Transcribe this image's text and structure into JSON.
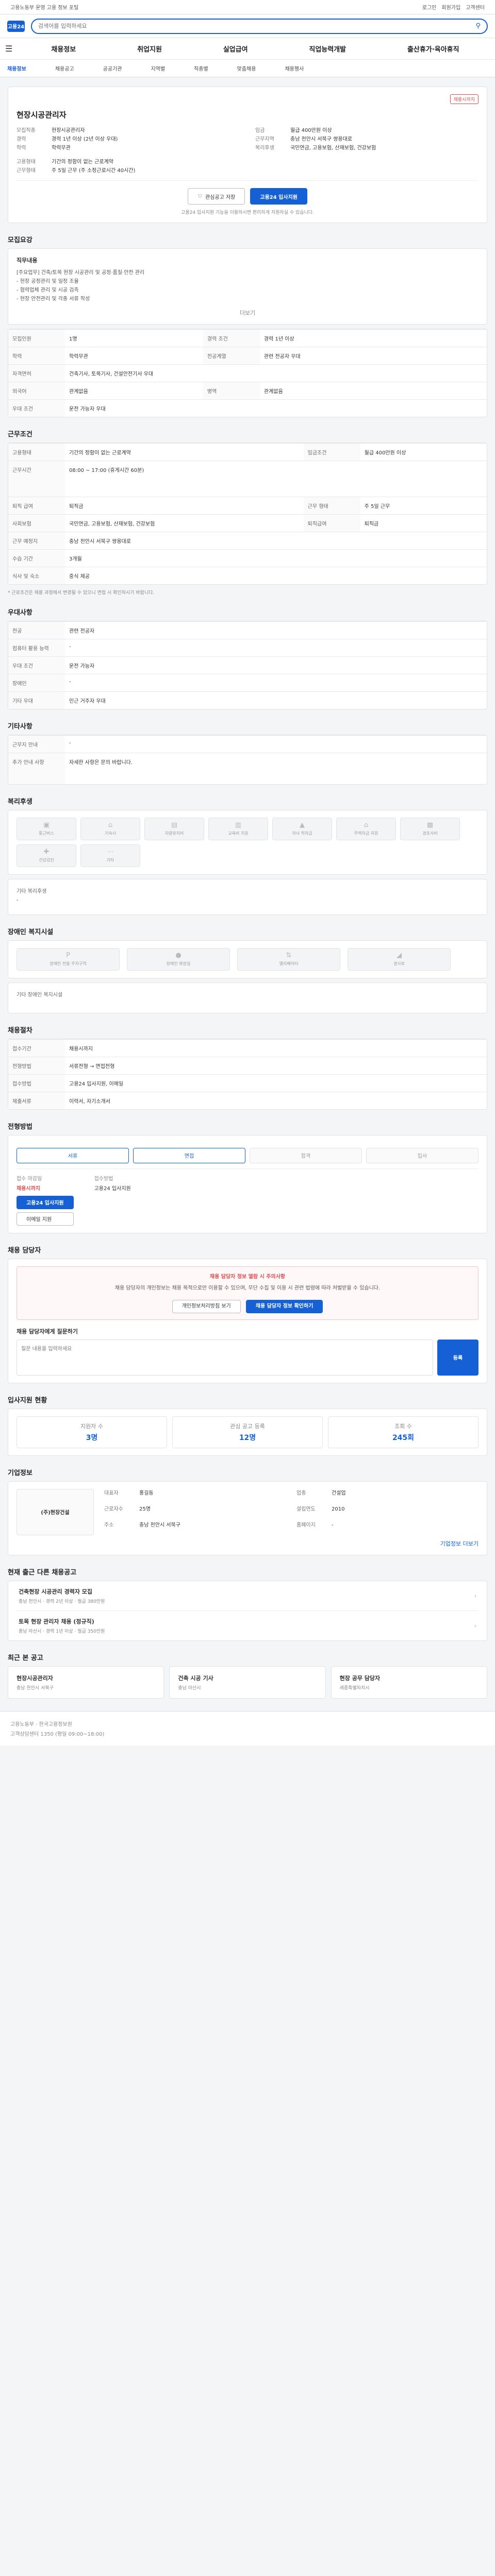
{
  "header": {
    "left_text": "고용노동부 운영 고용 정보 포털",
    "right_links": [
      "로그인",
      "회원가입",
      "고객센터"
    ],
    "logo": "고용24",
    "search_placeholder": "검색어를 입력하세요",
    "search_icon": "search-icon"
  },
  "nav": {
    "items": [
      "채용정보",
      "취업지원",
      "실업급여",
      "직업능력개발",
      "출산휴가·육아휴직"
    ],
    "sub": [
      "채용정보",
      "채용공고",
      "공공기관",
      "지역별",
      "직종별",
      "맞춤채용",
      "채용행사"
    ]
  },
  "job": {
    "org": "현장시공관리자",
    "badge": "채용시까지",
    "fields": [
      {
        "k": "모집직종",
        "v": "현장시공관리자"
      },
      {
        "k": "경력",
        "v": "경력 1년 이상 (2년 이상 우대)"
      },
      {
        "k": "학력",
        "v": "학력무관"
      },
      {
        "k": "고용형태",
        "v": "기간의 정함이 없는 근로계약"
      },
      {
        "k": "근무형태",
        "v": "주 5일 근무 (주 소정근로시간 40시간)"
      }
    ],
    "fields_right": [
      {
        "k": "임금",
        "v": "월급 400만원 이상"
      },
      {
        "k": "근무지역",
        "v": "충남 천안시 서북구 쌍용대로"
      },
      {
        "k": "복리후생",
        "v": "국민연금, 고용보험, 산재보험, 건강보험"
      }
    ],
    "btn_save": "관심공고 저장",
    "btn_apply": "고용24 입사지원",
    "apply_note": "고용24 입사지원 기능을 이용하시면 편리하게 지원하실 수 있습니다."
  },
  "sections": {
    "recruit": "모집요강",
    "conditions": "근무조건",
    "preference": "우대사항",
    "other": "기타사항",
    "welfare": "복리후생",
    "disability": "장애인 복지시설",
    "process": "채용절차",
    "docs": "전형방법",
    "manager": "채용 담당자",
    "status": "입사지원 현황",
    "agency": "기업정보",
    "similar": "현재 출근 다른 채용공고",
    "recent": "최근 본 공고"
  },
  "recruit_detail": {
    "title": "직무내용",
    "body": [
      "[주요업무] 건축/토목 현장 시공관리 및 공정·품질·안전 관리",
      "- 현장 공정관리 및 일정 조율",
      "- 협력업체 관리 및 시공 검측",
      "- 현장 안전관리 및 각종 서류 작성"
    ],
    "detail_link": "더보기"
  },
  "recruit_table": [
    {
      "k": "모집인원",
      "v": "1명",
      "k2": "경력 조건",
      "v2": "경력 1년 이상"
    },
    {
      "k": "학력",
      "v": "학력무관",
      "k2": "전공계열",
      "v2": "관련 전공자 우대"
    },
    {
      "k": "자격면허",
      "v": "건축기사, 토목기사, 건설안전기사 우대",
      "k2": "",
      "v2": ""
    },
    {
      "k": "외국어",
      "v": "관계없음",
      "k2": "병역",
      "v2": "관계없음"
    },
    {
      "k": "우대 조건",
      "v": "운전 가능자 우대",
      "k2": "",
      "v2": ""
    }
  ],
  "cond_table": [
    {
      "k": "고용형태",
      "v": "기간의 정함이 없는 근로계약",
      "k2": "임금조건",
      "v2": "월급 400만원 이상"
    },
    {
      "k": "근무시간",
      "v": "08:00 ~ 17:00 (휴게시간 60분)",
      "k2": "",
      "v2": ""
    },
    {
      "k": "퇴직 급여",
      "v": "퇴직금",
      "k2": "근무 형태",
      "v2": "주 5일 근무"
    },
    {
      "k": "사회보험",
      "v": "국민연금, 고용보험, 산재보험, 건강보험",
      "k2": "퇴직급여",
      "v2": "퇴직금"
    },
    {
      "k": "근무 예정지",
      "v": "충남 천안시 서북구 쌍용대로",
      "k2": "",
      "v2": ""
    },
    {
      "k": "수습 기간",
      "v": "3개월",
      "k2": "",
      "v2": ""
    },
    {
      "k": "식사 및 숙소",
      "v": "중식 제공",
      "k2": "",
      "v2": ""
    }
  ],
  "cond_note": "* 근로조건은 채용 과정에서 변경될 수 있으니 면접 시 확인하시기 바랍니다.",
  "pref_table": [
    {
      "k": "전공",
      "v": "관련 전공자"
    },
    {
      "k": "컴퓨터 활용 능력",
      "v": "-"
    },
    {
      "k": "우대 조건",
      "v": "운전 가능자"
    },
    {
      "k": "장애인",
      "v": "-"
    },
    {
      "k": "기타 우대",
      "v": "인근 거주자 우대"
    }
  ],
  "other_table": [
    {
      "k": "근무지 안내",
      "v": "-"
    },
    {
      "k": "추가 안내 사항",
      "v": "자세한 사항은 문의 바랍니다."
    }
  ],
  "welfare_items": [
    "통근버스",
    "기숙사",
    "차량유지비",
    "교육비 지원",
    "자녀 학자금",
    "주택자금 지원",
    "경조사비",
    "건강검진",
    "기타"
  ],
  "welfare_other": "기타 복리후생",
  "welfare_other_val": "-",
  "disability_items": [
    "장애인 전용 주차구역",
    "장애인 화장실",
    "엘리베이터",
    "경사로"
  ],
  "disability_other": "기타 장애인 복지시설",
  "process_table": [
    {
      "k": "접수기간",
      "v": "채용시까지",
      "k2": "",
      "v2": ""
    },
    {
      "k": "전형방법",
      "v": "서류전형 → 면접전형",
      "k2": "",
      "v2": ""
    },
    {
      "k": "접수방법",
      "v": "고용24 입사지원, 이메일",
      "k2": "",
      "v2": ""
    },
    {
      "k": "제출서류",
      "v": "이력서, 자기소개서",
      "k2": "",
      "v2": ""
    }
  ],
  "steps": [
    "서류",
    "면접",
    "합격",
    "입사"
  ],
  "deadline": {
    "label": "접수 마감일",
    "value": "채용시까지",
    "method_label": "접수방법",
    "method_value": "고용24 입사지원",
    "apply_btn": "고용24 입사지원",
    "email_btn": "이메일 지원"
  },
  "manager": {
    "alert": "채용 담당자 정보 열람 시 주의사항",
    "alert_body": "채용 담당자의 개인정보는 채용 목적으로만 이용할 수 있으며, 무단 수집 및 이용 시 관련 법령에 따라 처벌받을 수 있습니다.",
    "btn1": "개인정보처리방침 보기",
    "btn2": "채용 담당자 정보 확인하기",
    "inquiry_title": "채용 담당자에게 질문하기",
    "inquiry_placeholder": "질문 내용을 입력하세요",
    "submit": "등록"
  },
  "status": {
    "stats": [
      {
        "label": "지원자 수",
        "value": "3명"
      },
      {
        "label": "관심 공고 등록",
        "value": "12명"
      },
      {
        "label": "조회 수",
        "value": "245회"
      }
    ]
  },
  "company": {
    "name": "(주)현장건설",
    "fields": [
      {
        "k": "대표자",
        "v": "홍길동"
      },
      {
        "k": "업종",
        "v": "건설업"
      },
      {
        "k": "근로자수",
        "v": "25명"
      },
      {
        "k": "설립연도",
        "v": "2010"
      },
      {
        "k": "주소",
        "v": "충남 천안시 서북구"
      },
      {
        "k": "홈페이지",
        "v": "-"
      }
    ],
    "more": "기업정보 더보기"
  },
  "similar": [
    {
      "title": "건축현장 시공관리 경력자 모집",
      "meta": "충남 천안시 · 경력 2년 이상 · 월급 380만원"
    },
    {
      "title": "토목 현장 관리자 채용 (정규직)",
      "meta": "충남 아산시 · 경력 1년 이상 · 월급 350만원"
    }
  ],
  "recent": [
    {
      "title": "현장시공관리자",
      "meta": "충남 천안시 서북구"
    },
    {
      "title": "건축 시공 기사",
      "meta": "충남 아산시"
    },
    {
      "title": "현장 공무 담당자",
      "meta": "세종특별자치시"
    }
  ],
  "footer": {
    "line1": "고용노동부 · 한국고용정보원",
    "line2": "고객상담센터 1350 (평일 09:00~18:00)"
  }
}
